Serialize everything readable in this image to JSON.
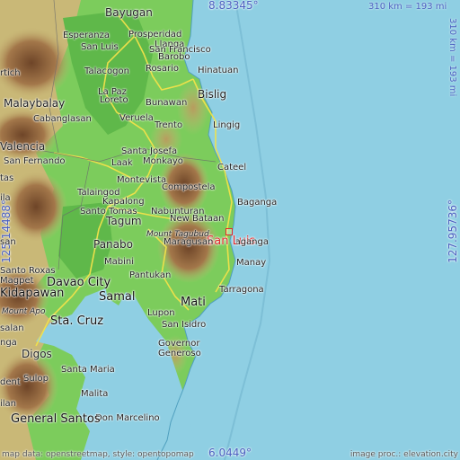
{
  "coordinates": {
    "top": "8.83345°",
    "bottom": "6.0449°",
    "left": "125.14488°",
    "right": "127.95736°"
  },
  "scale": {
    "horizontal": "310 km = 193 mi",
    "vertical": "310 km = 193 mi"
  },
  "highlight": {
    "name": "San Luis"
  },
  "places": {
    "bayugan": "Bayugan",
    "esperanza": "Esperanza",
    "prosperidad": "Prosperidad",
    "llanga": "Llanga",
    "san_luis_north": "San Luis",
    "san_francisco": "San Francisco",
    "talacogon": "Talacogon",
    "barobo": "Barobo",
    "rosario": "Rosario",
    "hinatuan": "Hinatuan",
    "bislig": "Bislig",
    "la_paz": "La Paz",
    "loreto": "Loreto",
    "bunawan": "Bunawan",
    "malaybalay": "Malaybalay",
    "cabanglasan": "Cabanglasan",
    "veruela": "Veruela",
    "trento": "Trento",
    "lingig": "Lingig",
    "valencia": "Valencia",
    "santa_josefa": "Santa Josefa",
    "san_fernando": "San Fernando",
    "laak": "Laak",
    "monkayo": "Monkayo",
    "cateel": "Cateel",
    "montevista": "Montevista",
    "compostela": "Compostela",
    "baganga": "Baganga",
    "talaingod": "Talaingod",
    "kapalong": "Kapalong",
    "nabunturan": "Nabunturan",
    "santo_tomas": "Santo Tomas",
    "new_bataan": "New Bataan",
    "tagum": "Tagum",
    "mount_tagubud": "Mount Tagubud",
    "maragusan": "Maragusan",
    "baganga_s": "Baganga",
    "panabo": "Panabo",
    "mabini": "Mabini",
    "manay": "Manay",
    "santo_roxas": "Santo Roxas",
    "magpet": "Magpet",
    "davao_city": "Davao City",
    "pantukan": "Pantukan",
    "tarragona": "Tarragona",
    "kidapawan": "Kidapawan",
    "samal": "Samal",
    "mati": "Mati",
    "mount_apo": "Mount Apo",
    "sta_cruz": "Sta. Cruz",
    "lupon": "Lupon",
    "san_isidro": "San Isidro",
    "digos": "Digos",
    "governor_generoso": "Governor Generoso",
    "santa_maria": "Santa Maria",
    "sulop": "Sulop",
    "malita": "Malita",
    "don_marcelino": "Don Marcelino",
    "general_santos": "General Santos",
    "partial_1": "rtich",
    "partial_2": "tas",
    "partial_3": "ila",
    "partial_4": "san",
    "partial_5": "salan",
    "partial_6": "nga",
    "partial_7": "dent",
    "partial_8": "ilan"
  },
  "credits": {
    "left": "map data: openstreetmap, style: opentopomap",
    "right": "image proc.: elevation.city"
  },
  "colors": {
    "sea": "#8fcfe3",
    "lowland": "#7ccc5c",
    "hills": "#c9b877",
    "mountains": "#8a5e3a",
    "highlight": "#e0282c",
    "coords": "#4a5fc0"
  }
}
